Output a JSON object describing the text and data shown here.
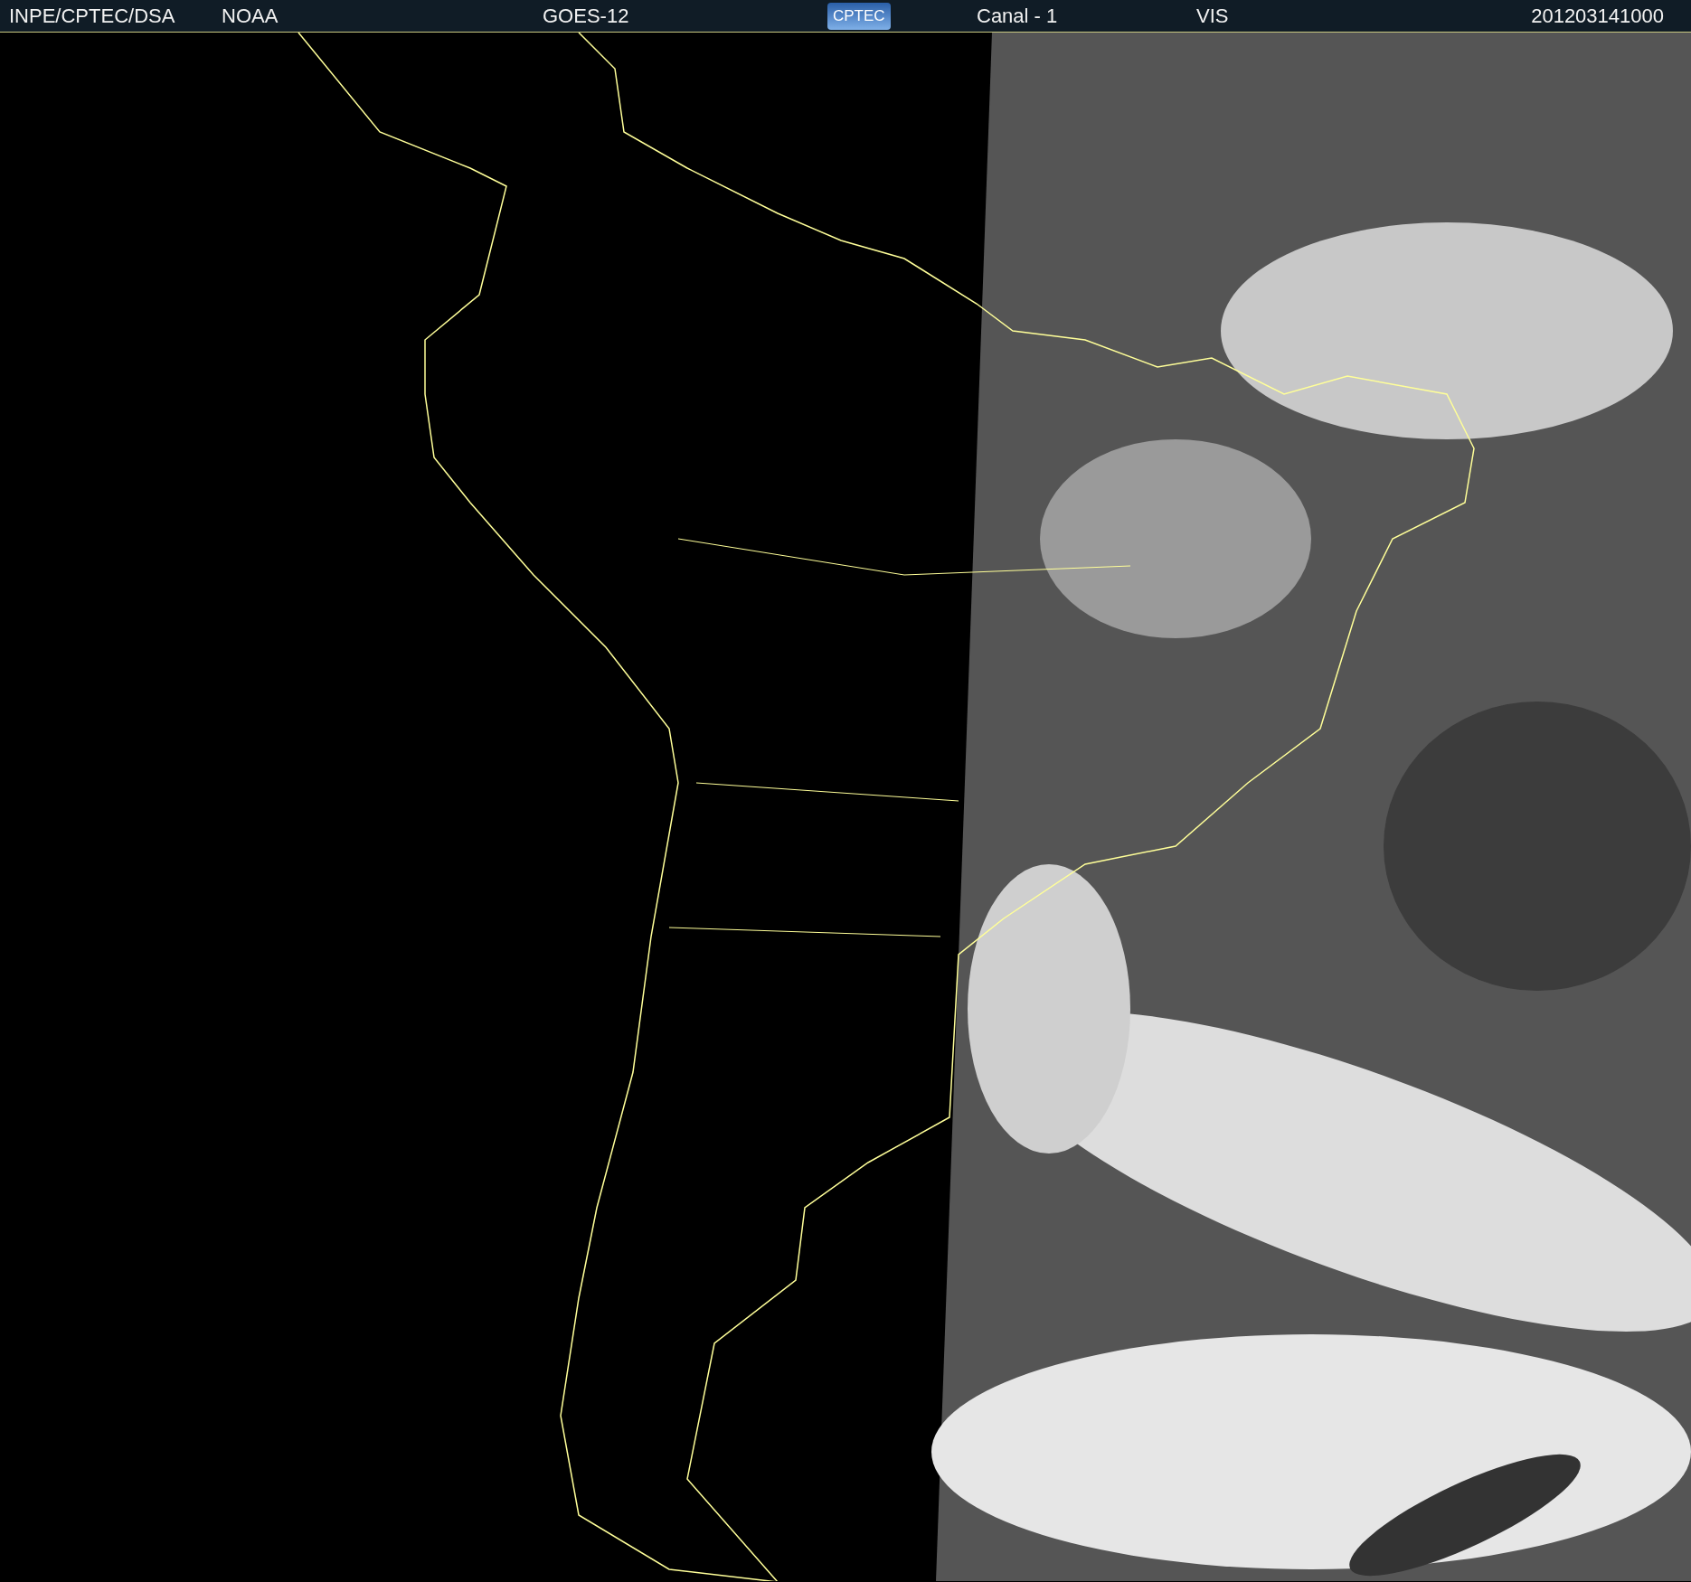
{
  "header": {
    "items": [
      {
        "kind": "text",
        "label": "INPE/CPTEC/DSA"
      },
      {
        "kind": "text",
        "label": "NOAA"
      },
      {
        "kind": "text",
        "label": "GOES-12"
      },
      {
        "kind": "logo",
        "label": "CPTEC"
      },
      {
        "kind": "text",
        "label": "Canal - 1"
      },
      {
        "kind": "text",
        "label": "VIS"
      },
      {
        "kind": "text",
        "label": "201203141000"
      }
    ]
  }
}
